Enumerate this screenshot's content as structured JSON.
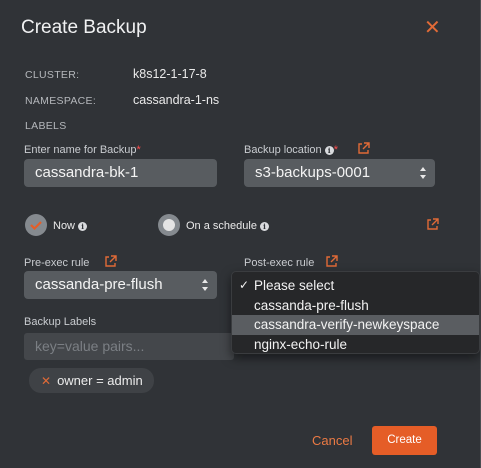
{
  "modal": {
    "title": "Create Backup",
    "close_glyph": "✕"
  },
  "meta": {
    "cluster_label": "CLUSTER:",
    "cluster_value": "k8s12-1-17-8",
    "namespace_label": "NAMESPACE:",
    "namespace_value": "cassandra-1-ns",
    "labels_label": "LABELS"
  },
  "form": {
    "name_label": "Enter name for Backup",
    "name_value": "cassandra-bk-1",
    "location_label": "Backup location",
    "location_value": "s3-backups-0001",
    "schedule_now_label": "Now",
    "schedule_sched_label": "On a schedule",
    "schedule_selected": "Now",
    "pre_exec_label": "Pre-exec rule",
    "pre_exec_value": "cassanda-pre-flush",
    "post_exec_label": "Post-exec rule",
    "backup_labels_label": "Backup Labels",
    "backup_labels_placeholder": "key=value pairs...",
    "chip_label": "owner = admin",
    "required_mark": "*",
    "info_glyph": "i"
  },
  "dropdown": {
    "items": [
      {
        "label": "Please select",
        "checked": true,
        "highlighted": false
      },
      {
        "label": "cassanda-pre-flush",
        "checked": false,
        "highlighted": false
      },
      {
        "label": "cassandra-verify-newkeyspace",
        "checked": false,
        "highlighted": true
      },
      {
        "label": "nginx-echo-rule",
        "checked": false,
        "highlighted": false
      }
    ],
    "check_glyph": "✓"
  },
  "footer": {
    "cancel_label": "Cancel",
    "create_label": "Create"
  },
  "colors": {
    "accent": "#e55d27",
    "modal_bg": "#303337",
    "input_bg": "#585c60"
  }
}
